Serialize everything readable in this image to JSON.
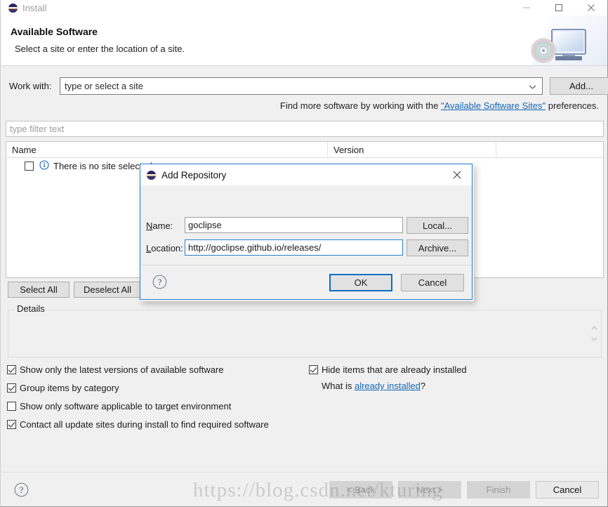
{
  "window": {
    "title": "Install",
    "logo_icon": "eclipse-logo",
    "controls": [
      {
        "name": "minimize",
        "icon": "minimize-icon"
      },
      {
        "name": "maximize",
        "icon": "maximize-icon"
      },
      {
        "name": "close",
        "icon": "close-icon"
      }
    ]
  },
  "header": {
    "title": "Available Software",
    "subtitle": "Select a site or enter the location of a site.",
    "graphic_icon": "monitor-cd-install-icon"
  },
  "work_with": {
    "label": "Work with:",
    "value": "",
    "placeholder": "type or select a site",
    "dropdown_icon": "chevron-down-icon",
    "add_button": "Add..."
  },
  "find_more": {
    "prefix": "Find more software by working with the ",
    "link": "\"Available Software Sites\"",
    "suffix": " preferences."
  },
  "filter": {
    "value": "",
    "placeholder": "type filter text"
  },
  "tree": {
    "columns": [
      "Name",
      "Version"
    ],
    "rows": [
      {
        "checked": false,
        "icon": "info-icon",
        "label": "There is no site selected"
      }
    ]
  },
  "list_buttons": {
    "select_all": "Select All",
    "deselect_all": "Deselect All"
  },
  "details": {
    "legend": "Details",
    "content": "",
    "stepper_icon": "spinner-stepper-icon"
  },
  "options_left": [
    {
      "checked": true,
      "label": "Show only the latest versions of available software"
    },
    {
      "checked": true,
      "label": "Group items by category"
    },
    {
      "checked": false,
      "label": "Show only software applicable to target environment"
    },
    {
      "checked": true,
      "label": "Contact all update sites during install to find required software"
    }
  ],
  "options_right": {
    "hide_installed": {
      "checked": true,
      "label": "Hide items that are already installed"
    },
    "what_is_prefix": "What is ",
    "what_is_link": "already installed",
    "what_is_suffix": "?"
  },
  "footer": {
    "help_icon": "help-question-icon",
    "buttons": [
      {
        "label": "< Back",
        "enabled": false
      },
      {
        "label": "Next >",
        "enabled": false
      },
      {
        "label": "Finish",
        "enabled": false
      },
      {
        "label": "Cancel",
        "enabled": true
      }
    ]
  },
  "modal": {
    "title": "Add Repository",
    "logo_icon": "eclipse-logo",
    "close_icon": "close-icon",
    "name_label": "Name:",
    "name_label_mnemonic": "N",
    "name_label_rest": "ame:",
    "name_value": "goclipse",
    "location_label_mnemonic": "L",
    "location_label_rest": "ocation:",
    "location_value": "http://goclipse.github.io/releases/",
    "local_button": "Local...",
    "archive_button": "Archive...",
    "help_icon": "help-question-icon",
    "ok_button": "OK",
    "cancel_button": "Cancel"
  },
  "watermark": {
    "text": "https://blog.csdn.net/kturing"
  },
  "colors": {
    "accent_blue": "#0b6ec4",
    "link_blue": "#1464b4",
    "window_bg": "#f0f0f0",
    "field_bg": "#ffffff",
    "button_bg": "#e1e1e1"
  }
}
